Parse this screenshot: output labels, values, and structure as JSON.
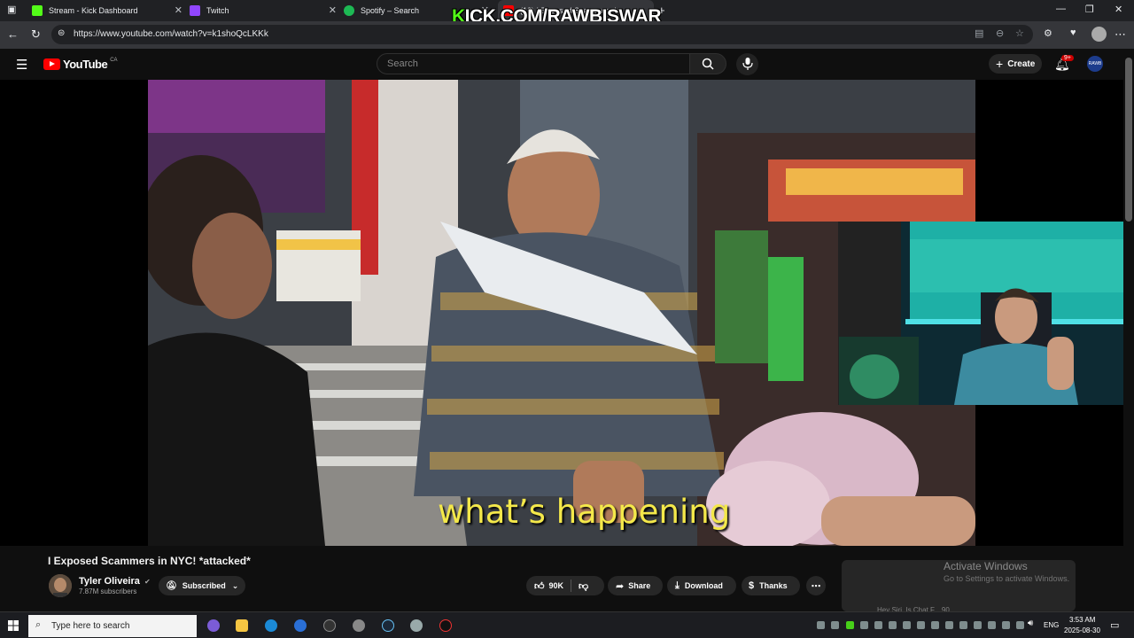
{
  "browser": {
    "tabs": [
      {
        "label": "Stream - Kick Dashboard",
        "favicon_color": "#53fc18"
      },
      {
        "label": "Twitch",
        "favicon_color": "#9146ff"
      },
      {
        "label": "Spotify – Search",
        "favicon_color": "#1db954"
      },
      {
        "label": "(13) I Exposed Scammers in",
        "favicon_color": "#ff0000"
      }
    ],
    "url": "https://www.youtube.com/watch?v=k1shoQcLKKk",
    "overlay_text": "KICK.COM/RAWBISWAR"
  },
  "youtube": {
    "logo_text": "YouTube",
    "logo_region": "CA",
    "search_placeholder": "Search",
    "create_label": "Create",
    "notifications_badge": "9+",
    "avatar_text": "RAWB",
    "caption": "what’s happening",
    "video_title": "I Exposed Scammers in NYC! *attacked*",
    "channel": {
      "name": "Tyler Oliveira",
      "subscribers": "7.87M subscribers",
      "subscribe_label": "Subscribed"
    },
    "actions": {
      "likes": "90K",
      "share": "Share",
      "download": "Download",
      "thanks": "Thanks"
    },
    "sidebar_preview": "Hey Siri, Is Chat F... 90"
  },
  "windows": {
    "activate_title": "Activate Windows",
    "activate_sub": "Go to Settings to activate Windows.",
    "taskbar_search": "Type here to search",
    "language": "ENG",
    "time": "3:53 AM",
    "date": "2025-08-30"
  },
  "colors": {
    "kick_green": "#53fc18",
    "youtube_red": "#ff0000",
    "caption_yellow": "#f4e84a"
  }
}
